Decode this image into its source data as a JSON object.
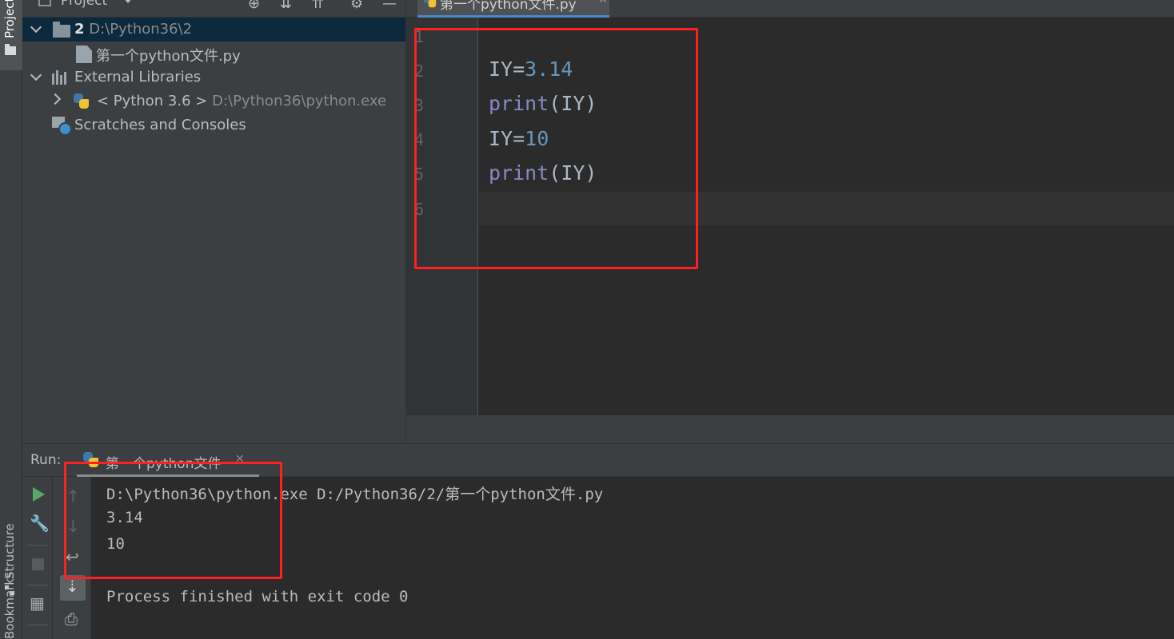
{
  "left_strip": {
    "project_label": "Project",
    "structure_label": "Structure",
    "bookmarks_label": "Bookmarks"
  },
  "project_panel": {
    "title": "Project",
    "tree": {
      "root_name": "2",
      "root_path": "D:\\Python36\\2",
      "file_name": "第一个python文件.py",
      "external_libraries": "External Libraries",
      "python_sdk": "< Python 3.6 >",
      "python_sdk_path": "D:\\Python36\\python.exe",
      "scratches": "Scratches and Consoles"
    }
  },
  "editor": {
    "tab_label": "第一个python文件.py",
    "line_numbers": [
      "1",
      "2",
      "3",
      "4",
      "5",
      "6"
    ],
    "code": {
      "line2_var": "IY=",
      "line2_num": "3.14",
      "line3_fn": "print",
      "line3_args": "(IY)",
      "line4_var": "IY=",
      "line4_num": "10",
      "line5_fn": "print",
      "line5_args": "(IY)"
    }
  },
  "run": {
    "title": "Run:",
    "tab_label": "第一个python文件",
    "console_lines": [
      "D:\\Python36\\python.exe D:/Python36/2/第一个python文件.py",
      "3.14",
      "10",
      "",
      "Process finished with exit code 0"
    ]
  },
  "colors": {
    "annotation_red": "#ff2020",
    "number_blue": "#6897bb",
    "builtin_purple": "#8888c6",
    "run_green": "#59a869"
  },
  "icons": [
    "folder-icon",
    "python-file-icon",
    "library-icon",
    "python-sdk-icon",
    "scratches-icon",
    "locate-icon",
    "collapse-all-icon",
    "expand-all-icon",
    "gear-icon",
    "minimize-icon",
    "play-icon",
    "wrench-icon",
    "stop-icon",
    "layout-icon",
    "up-arrow-icon",
    "down-arrow-icon",
    "soft-wrap-icon",
    "scroll-to-end-icon",
    "print-icon"
  ]
}
